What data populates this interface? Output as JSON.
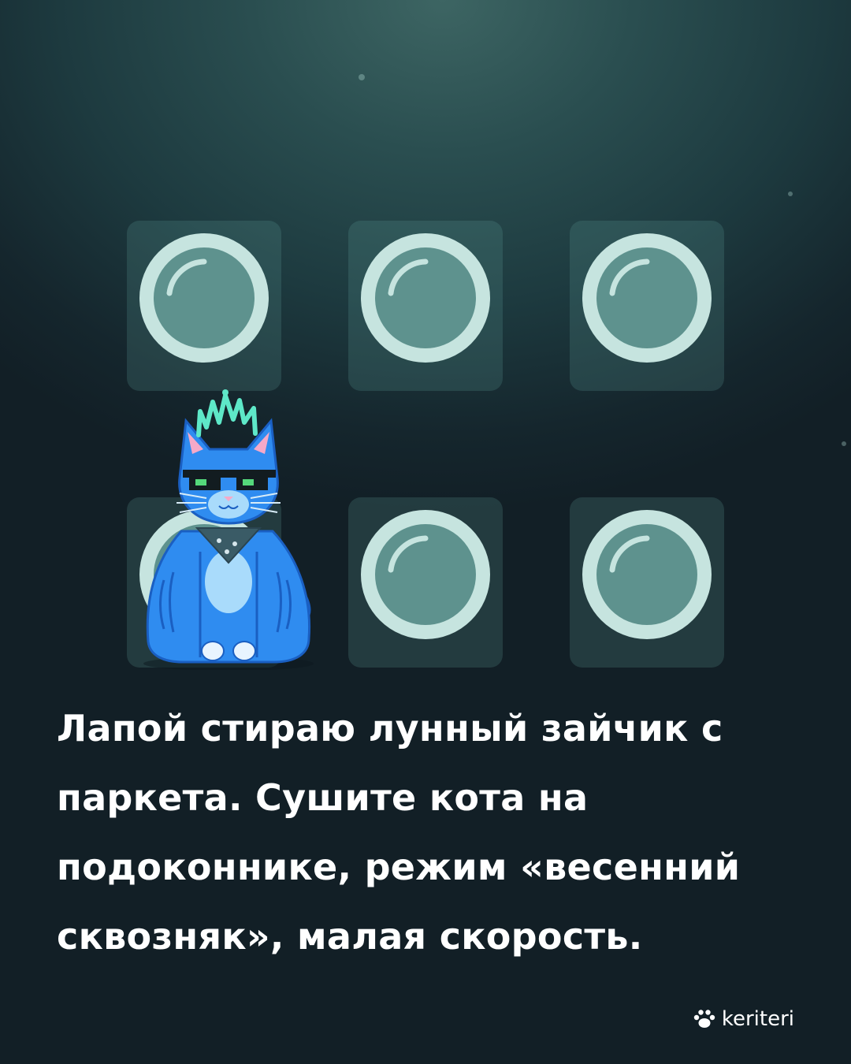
{
  "caption": "Лапой стираю лунный зайчик с паркета. Сушите кота на подоконнике, режим «весенний сквозняк», малая скорость.",
  "brand": {
    "name": "keriteri",
    "icon": "paw-icon"
  },
  "grid": {
    "rows": 2,
    "columns": 3,
    "item_icon": "lunar-ring-icon"
  },
  "colors": {
    "background": "#1d3a3f",
    "tile": "#2f5a5b",
    "ring": "#c6e4df",
    "ring_inner": "#5e928e",
    "cat_body": "#2f8cf0",
    "crest": "#5ee8c8",
    "text": "#ffffff"
  }
}
